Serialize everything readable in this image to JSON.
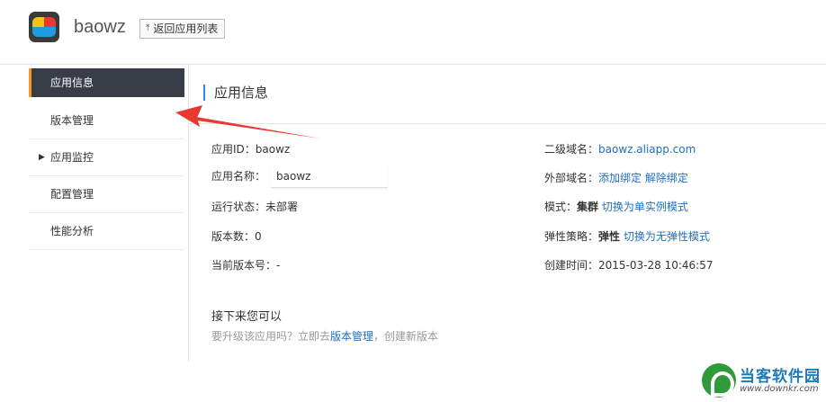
{
  "header": {
    "app_name": "baowz",
    "back_label": "返回应用列表"
  },
  "sidebar": {
    "items": [
      {
        "label": "应用信息"
      },
      {
        "label": "版本管理"
      },
      {
        "label": "应用监控"
      },
      {
        "label": "配置管理"
      },
      {
        "label": "性能分析"
      }
    ]
  },
  "section": {
    "title": "应用信息"
  },
  "info": {
    "app_id_label": "应用ID：",
    "app_id": "baowz",
    "app_name_label": "应用名称：",
    "app_name": "baowz",
    "status_label": "运行状态：",
    "status": "未部署",
    "version_count_label": "版本数：",
    "version_count": "0",
    "current_version_label": "当前版本号：",
    "current_version": "-",
    "subdomain_label": "二级域名：",
    "subdomain": "baowz.aliapp.com",
    "external_domain_label": "外部域名：",
    "add_bind": "添加绑定",
    "remove_bind": "解除绑定",
    "mode_label": "模式：",
    "mode_value": "集群",
    "mode_switch": "切换为单实例模式",
    "elastic_label": "弹性策略：",
    "elastic_value": "弹性",
    "elastic_switch": "切换为无弹性模式",
    "created_label": "创建时间：",
    "created": "2015-03-28 10:46:57"
  },
  "next": {
    "title": "接下来您可以",
    "desc_prefix": "要升级该应用吗？立即去",
    "desc_link": "版本管理",
    "desc_suffix": "，创建新版本"
  },
  "watermark": {
    "name": "当客软件园",
    "url": "www.downkr.com"
  },
  "colors": {
    "active_nav_bg": "#383d47",
    "active_nav_accent": "#f59a23",
    "link": "#1f6fbf",
    "annotation_arrow": "#e8382f"
  }
}
